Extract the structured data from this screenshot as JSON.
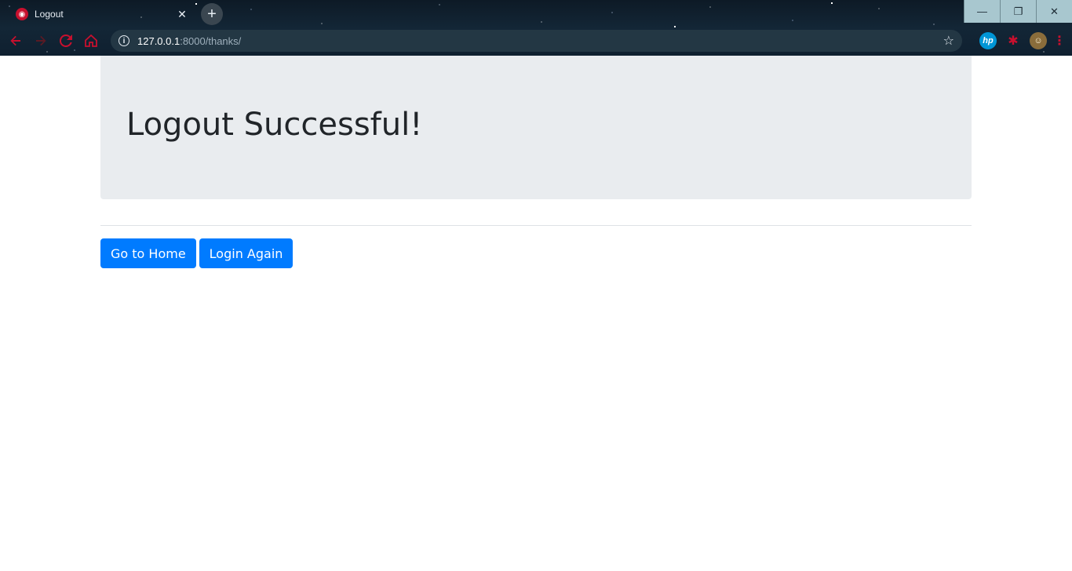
{
  "browser": {
    "tab": {
      "title": "Logout",
      "favicon": "app-favicon-icon",
      "close_glyph": "✕"
    },
    "new_tab_glyph": "+",
    "window_controls": {
      "minimize": "—",
      "restore": "❐",
      "close": "✕"
    },
    "nav": {
      "back": "back-arrow-icon",
      "forward": "forward-arrow-icon",
      "reload": "reload-icon",
      "home": "home-icon"
    },
    "address_bar": {
      "host": "127.0.0.1",
      "path": ":8000/thanks/"
    },
    "extensions": {
      "hp_label": "hp"
    },
    "accent_color": "#c8102e"
  },
  "page": {
    "heading": "Logout Successful!",
    "buttons": {
      "home_label": "Go to Home",
      "login_label": "Login Again"
    },
    "colors": {
      "jumbotron_bg": "#e9ecef",
      "button_primary": "#007bff",
      "heading_text": "#212529"
    }
  }
}
